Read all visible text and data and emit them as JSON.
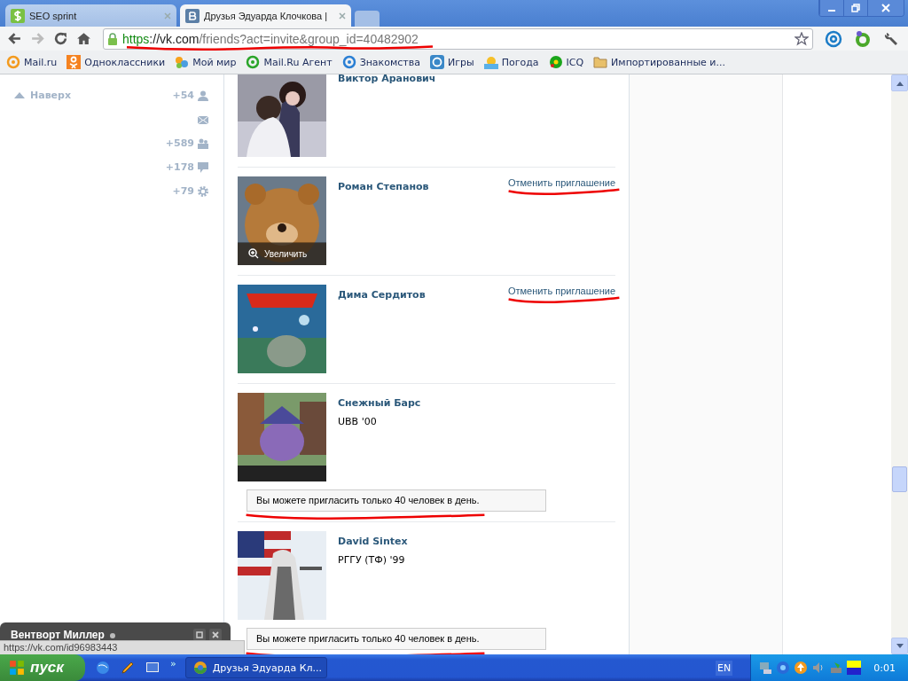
{
  "tabs": [
    {
      "title": "SEO sprint",
      "selected": false
    },
    {
      "title": "Друзья Эдуарда Клочкова |",
      "selected": true
    }
  ],
  "address": {
    "scheme": "https",
    "host": "://vk.com",
    "path": "/friends?act=invite&group_id=40482902",
    "underlined": true
  },
  "bookmarks": [
    "Mail.ru",
    "Одноклассники",
    "Мой мир",
    "Mail.Ru Агент",
    "Знакомства",
    "Игры",
    "Погода",
    "ICQ",
    "Импортированные и..."
  ],
  "sidebar": {
    "top_link": "Наверх",
    "counters": [
      {
        "kind": "person",
        "count": "+54"
      },
      {
        "kind": "mail"
      },
      {
        "kind": "group",
        "count": "+589"
      },
      {
        "kind": "comment",
        "count": "+178"
      },
      {
        "kind": "gear",
        "count": "+79"
      }
    ]
  },
  "friends": [
    {
      "name": "Виктор Аранович"
    },
    {
      "name": "Роман Степанов",
      "action": "Отменить приглашение",
      "underlined": true,
      "photo_overlay": "Увеличить"
    },
    {
      "name": "Дима Сердитов",
      "action": "Отменить приглашение",
      "underlined": true
    },
    {
      "name": "Снежный Барс",
      "subtitle": "UBB '00",
      "notice": "Вы можете пригласить только 40 человек в день.",
      "underlined": true
    },
    {
      "name": "David Sintex",
      "subtitle": "РГГУ (ТФ) '99",
      "notice": "Вы можете пригласить только 40 человек в день.",
      "underlined": true
    }
  ],
  "chat": {
    "name": "Вентворт Миллер"
  },
  "status_url": "https://vk.com/id96983443",
  "taskbar": {
    "start": "пуск",
    "more": "»",
    "task": "Друзья Эдуарда Кл...",
    "lang": "EN",
    "clock": "0:01"
  }
}
